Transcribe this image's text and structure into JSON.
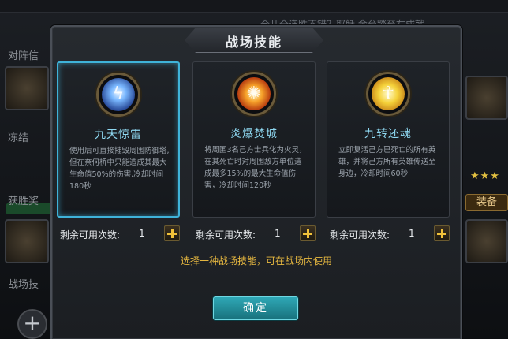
{
  "background": {
    "ticker": "仓儿全连胜不错？耶稣 金台踏至左成就",
    "left_labels": [
      "对阵信",
      "冻结",
      "获胜奖",
      "战场技"
    ],
    "right_equip_label": "装备",
    "stars": "★★★"
  },
  "dialog": {
    "title": "战场技能",
    "skills": [
      {
        "name": "九天惊雷",
        "description": "使用后可直接摧毁周围防御塔,但在奈何桥中只能造成其最大生命值50%的伤害,冷却时间180秒",
        "icon": "lightning-icon",
        "uses_label": "剩余可用次数:",
        "uses_count": "1",
        "selected": true
      },
      {
        "name": "炎爆焚城",
        "description": "将周围3名己方士兵化为火灵，在其死亡时对周围敌方单位造成最多15%的最大生命值伤害，冷却时间120秒",
        "icon": "flame-burst-icon",
        "uses_label": "剩余可用次数:",
        "uses_count": "1",
        "selected": false
      },
      {
        "name": "九转还魂",
        "description": "立即复活己方已死亡的所有英雄，并将己方所有英雄传送至身边，冷却时间60秒",
        "icon": "revive-icon",
        "uses_label": "剩余可用次数:",
        "uses_count": "1",
        "selected": false
      }
    ],
    "hint": "选择一种战场技能，可在战场内使用",
    "confirm_label": "确定"
  },
  "colors": {
    "accent_cyan": "#3fb3d9",
    "hint_gold": "#e7b840",
    "plus_gold": "#f2c23a"
  }
}
